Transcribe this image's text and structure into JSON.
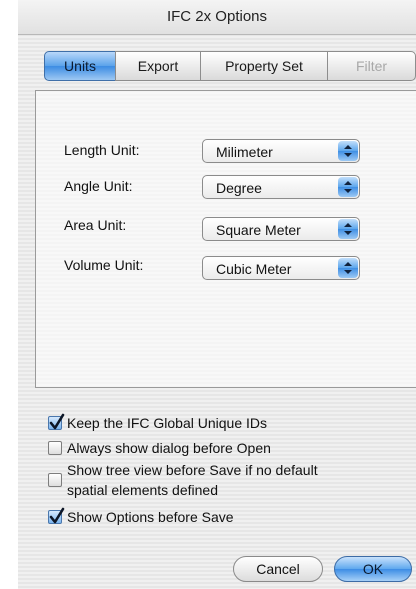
{
  "window": {
    "title": "IFC 2x Options"
  },
  "tabs": [
    {
      "label": "Units",
      "selected": true,
      "enabled": true
    },
    {
      "label": "Export",
      "selected": false,
      "enabled": true
    },
    {
      "label": "Property Set",
      "selected": false,
      "enabled": true
    },
    {
      "label": "Filter",
      "selected": false,
      "enabled": false
    }
  ],
  "units": {
    "length": {
      "label": "Length Unit:",
      "value": "Milimeter"
    },
    "angle": {
      "label": "Angle Unit:",
      "value": "Degree"
    },
    "area": {
      "label": "Area Unit:",
      "value": "Square Meter"
    },
    "volume": {
      "label": "Volume Unit:",
      "value": "Cubic Meter"
    }
  },
  "options": [
    {
      "label": "Keep the IFC Global Unique IDs",
      "checked": true
    },
    {
      "label": "Always show dialog before Open",
      "checked": false
    },
    {
      "label_line1": "Show tree view before Save if no default",
      "label_line2": "spatial elements defined",
      "checked": false
    },
    {
      "label": "Show Options before Save",
      "checked": true
    }
  ],
  "buttons": {
    "cancel": "Cancel",
    "ok": "OK"
  },
  "colors": {
    "accent": "#3c8ce3",
    "accent_light": "#b9d8fa",
    "disabled_text": "#a8a8a8"
  }
}
